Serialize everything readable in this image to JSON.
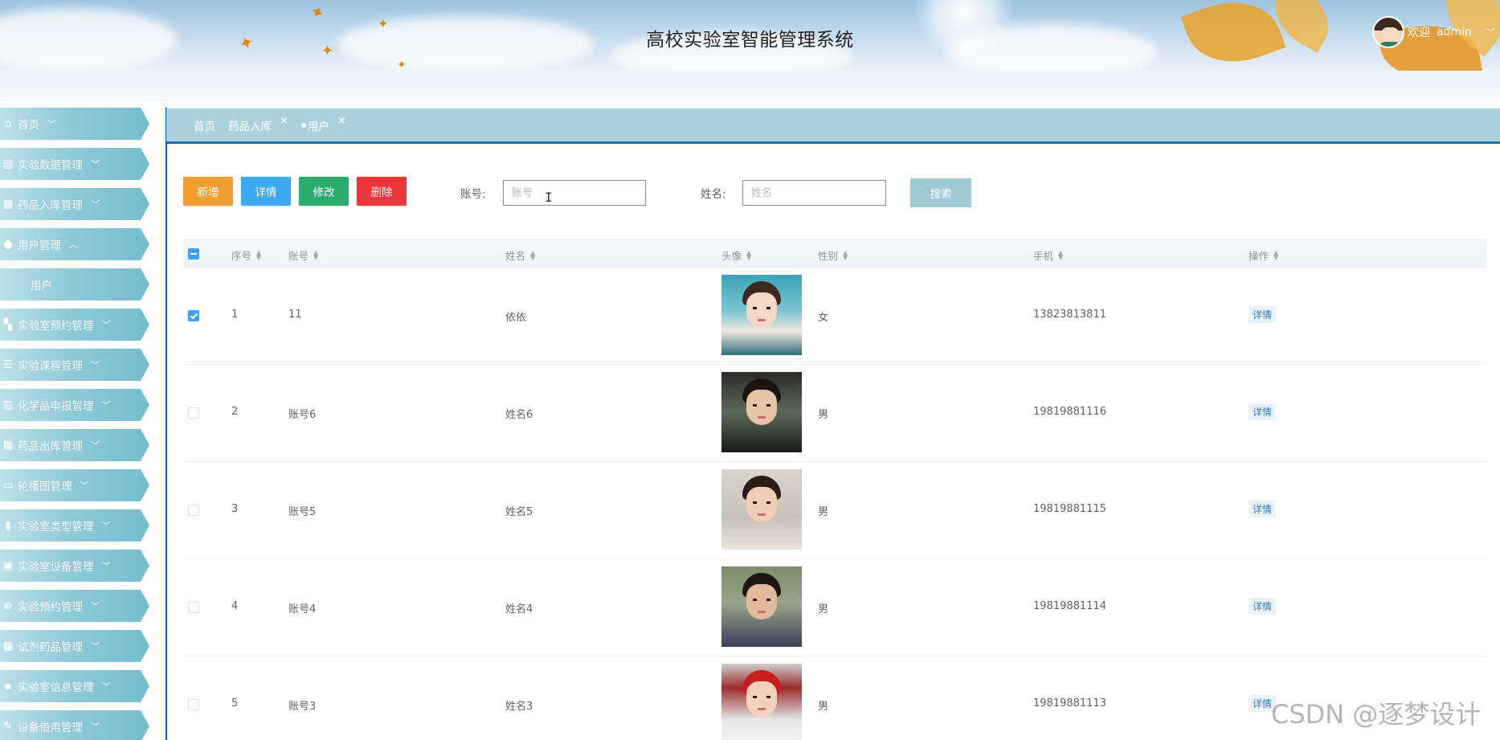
{
  "header": {
    "title": "高校实验室智能管理系统",
    "welcome": "欢迎",
    "username": "admin"
  },
  "sidebar": {
    "items": [
      {
        "label": "首页",
        "icon": "home-icon",
        "arrow": "﹀"
      },
      {
        "label": "实验数据管理",
        "icon": "document-icon",
        "arrow": "﹀"
      },
      {
        "label": "药品入库管理",
        "icon": "store-icon",
        "arrow": "﹀"
      },
      {
        "label": "用户管理",
        "icon": "user-icon",
        "arrow": "︿"
      },
      {
        "label": "用户",
        "icon": "",
        "arrow": ""
      },
      {
        "label": "实验室预约管理",
        "icon": "grid-icon",
        "arrow": "﹀"
      },
      {
        "label": "实验课程管理",
        "icon": "list-icon",
        "arrow": "﹀"
      },
      {
        "label": "化学品申报管理",
        "icon": "table-icon",
        "arrow": "﹀"
      },
      {
        "label": "药品出库管理",
        "icon": "store-icon",
        "arrow": "﹀"
      },
      {
        "label": "轮播图管理",
        "icon": "briefcase-icon",
        "arrow": "﹀"
      },
      {
        "label": "实验室类型管理",
        "icon": "columns-icon",
        "arrow": "﹀"
      },
      {
        "label": "实验室设备管理",
        "icon": "device-icon",
        "arrow": "﹀"
      },
      {
        "label": "实验预约管理",
        "icon": "circle-plus-icon",
        "arrow": "﹀"
      },
      {
        "label": "试剂药品管理",
        "icon": "box-icon",
        "arrow": "﹀"
      },
      {
        "label": "实验室信息管理",
        "icon": "id-card-icon",
        "arrow": "﹀"
      },
      {
        "label": "设备借用管理",
        "icon": "edit-icon",
        "arrow": "﹀"
      }
    ]
  },
  "tabs": [
    {
      "label": "首页",
      "close": ""
    },
    {
      "label": "药品入库",
      "close": "×"
    },
    {
      "label": "用户",
      "close": "×"
    }
  ],
  "toolbar": {
    "add": "新增",
    "detail": "详情",
    "edit": "修改",
    "delete": "删除",
    "search": "搜索"
  },
  "search": {
    "account_label": "账号:",
    "account_placeholder": "账号",
    "name_label": "姓名:",
    "name_placeholder": "姓名"
  },
  "table": {
    "columns": [
      "序号",
      "账号",
      "姓名",
      "头像",
      "性别",
      "手机",
      "操作"
    ],
    "rows": [
      {
        "index": "1",
        "account": "11",
        "name": "依依",
        "gender": "女",
        "phone": "13823813811",
        "action": "详情",
        "checked": true
      },
      {
        "index": "2",
        "account": "账号6",
        "name": "姓名6",
        "gender": "男",
        "phone": "19819881116",
        "action": "详情",
        "checked": false
      },
      {
        "index": "3",
        "account": "账号5",
        "name": "姓名5",
        "gender": "男",
        "phone": "19819881115",
        "action": "详情",
        "checked": false
      },
      {
        "index": "4",
        "account": "账号4",
        "name": "姓名4",
        "gender": "男",
        "phone": "19819881114",
        "action": "详情",
        "checked": false
      },
      {
        "index": "5",
        "account": "账号3",
        "name": "姓名3",
        "gender": "男",
        "phone": "19819881113",
        "action": "详情",
        "checked": false
      }
    ]
  },
  "watermark": "CSDN @逐梦设计",
  "colors": {
    "tabbar": "#acd3dc",
    "accent_line": "#2a6aa5",
    "add": "#f2a032",
    "detail": "#3da9f1",
    "edit": "#2bab6d",
    "delete": "#e9363d",
    "search": "#9fcad3"
  }
}
